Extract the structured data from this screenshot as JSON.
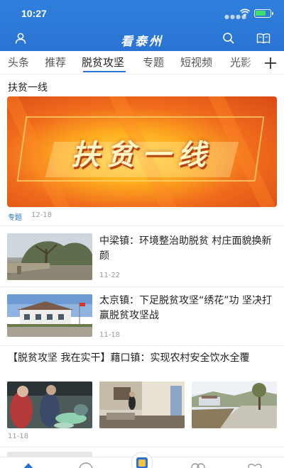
{
  "status_bar": {
    "time": "10:27"
  },
  "app_bar": {
    "title": "看泰州"
  },
  "tabs": [
    {
      "label": "头条"
    },
    {
      "label": "推荐"
    },
    {
      "label": "脱贫攻坚",
      "active": true
    },
    {
      "label": "专题"
    },
    {
      "label": "短视频"
    },
    {
      "label": "光影"
    }
  ],
  "section": {
    "title": "扶贫一线"
  },
  "featured": {
    "banner_text": "扶贫一线",
    "tag": "专题",
    "date": "12-18"
  },
  "news": [
    {
      "title": "中梁镇：环境整治助脱贫 村庄面貌换新颜",
      "date": "11-22"
    },
    {
      "title": "太京镇：下足脱贫攻坚“绣花”功 坚决打赢脱贫攻坚战",
      "date": "11-18"
    },
    {
      "title": "【脱贫攻坚 我在实干】藉口镇：实现农村安全饮水全覆",
      "date": "11-18"
    }
  ],
  "colors": {
    "accent": "#2a74d3",
    "battery": "#3ee06a"
  },
  "icons": [
    "user-icon",
    "search-icon",
    "book-icon",
    "plus-icon",
    "home-icon",
    "play-icon",
    "center-logo-icon",
    "community-icon",
    "heart-icon"
  ]
}
